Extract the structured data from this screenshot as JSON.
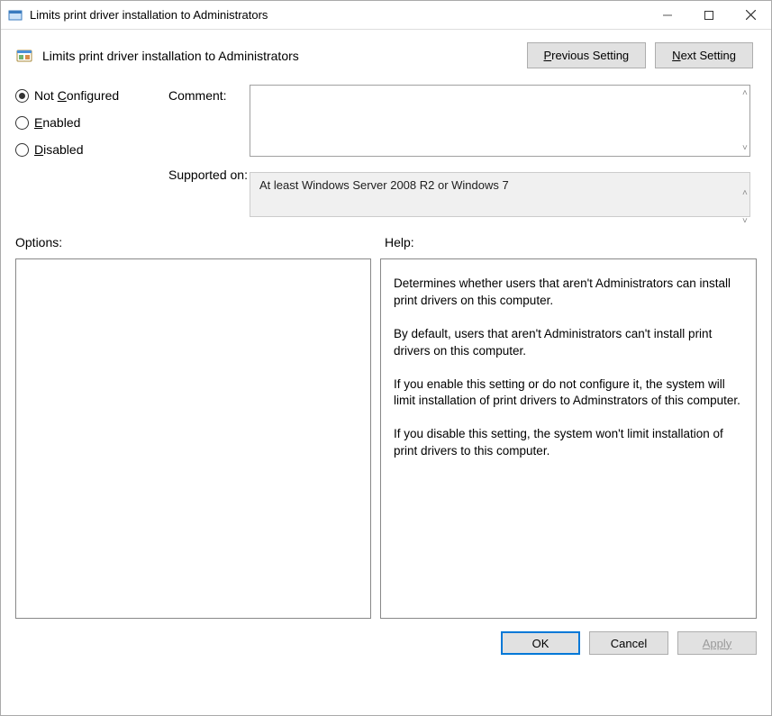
{
  "window": {
    "title": "Limits print driver installation to Administrators"
  },
  "header": {
    "title": "Limits print driver installation to Administrators",
    "prev_btn": "Previous Setting",
    "next_btn": "Next Setting"
  },
  "state": {
    "not_configured": "Not Configured",
    "enabled": "Enabled",
    "disabled": "Disabled",
    "selected": "not_configured"
  },
  "labels": {
    "comment": "Comment:",
    "supported_on": "Supported on:",
    "options": "Options:",
    "help": "Help:"
  },
  "fields": {
    "comment_value": "",
    "supported_on_value": "At least Windows Server 2008 R2 or Windows 7"
  },
  "help": {
    "p1": "Determines whether users that aren't Administrators can install print drivers on this computer.",
    "p2": "By default, users that aren't Administrators can't install print drivers on this computer.",
    "p3": "If you enable this setting or do not configure it, the system will limit installation of print drivers to Adminstrators of this computer.",
    "p4": "If you disable this setting, the system won't limit installation of print drivers to this computer."
  },
  "footer": {
    "ok": "OK",
    "cancel": "Cancel",
    "apply": "Apply"
  }
}
